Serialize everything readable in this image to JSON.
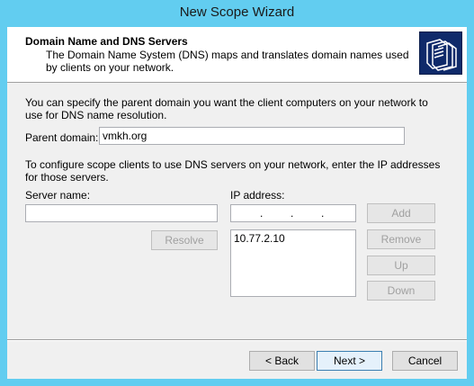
{
  "window": {
    "title": "New Scope Wizard"
  },
  "header": {
    "title": "Domain Name and DNS Servers",
    "description": "The Domain Name System (DNS) maps and translates domain names used by clients on your network."
  },
  "parent_domain": {
    "intro": "You can specify the parent domain you want the client computers on your network to use for DNS name resolution.",
    "label": "Parent domain:",
    "value": "vmkh.org"
  },
  "dns": {
    "intro": "To configure scope clients to use DNS servers on your network, enter the IP addresses for those servers.",
    "server_name_label": "Server name:",
    "server_name_value": "",
    "ip_address_label": "IP address:",
    "ip_dots": [
      ".",
      ".",
      "."
    ],
    "ip_list": [
      "10.77.2.10"
    ],
    "buttons": {
      "resolve": "Resolve",
      "add": "Add",
      "remove": "Remove",
      "up": "Up",
      "down": "Down"
    }
  },
  "footer": {
    "back": "< Back",
    "next": "Next >",
    "cancel": "Cancel"
  },
  "colors": {
    "title_bar": "#62cdf0",
    "header_bg": "#ffffff",
    "body_bg": "#f0f0f0",
    "icon_bg": "#0f2a6a"
  }
}
